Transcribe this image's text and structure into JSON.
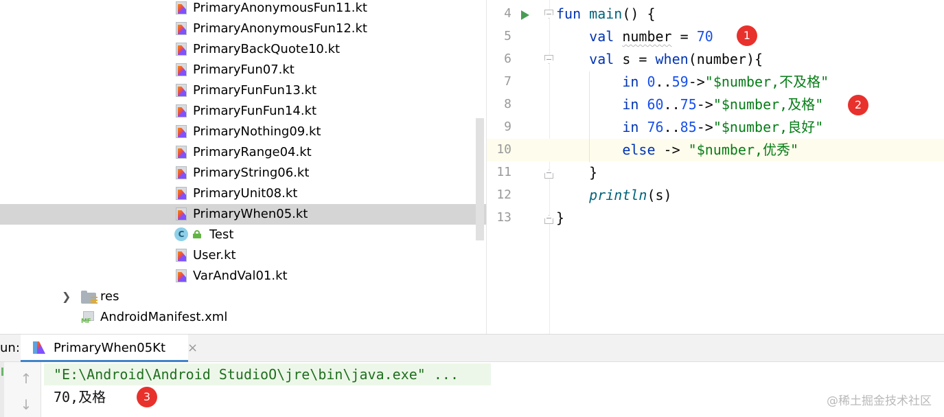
{
  "project_tree": {
    "files": [
      {
        "label": "PrimaryAnonymousFun11.kt",
        "type": "kotlin-file"
      },
      {
        "label": "PrimaryAnonymousFun12.kt",
        "type": "kotlin-file"
      },
      {
        "label": "PrimaryBackQuote10.kt",
        "type": "kotlin-file"
      },
      {
        "label": "PrimaryFun07.kt",
        "type": "kotlin-file"
      },
      {
        "label": "PrimaryFunFun13.kt",
        "type": "kotlin-file"
      },
      {
        "label": "PrimaryFunFun14.kt",
        "type": "kotlin-file"
      },
      {
        "label": "PrimaryNothing09.kt",
        "type": "kotlin-file"
      },
      {
        "label": "PrimaryRange04.kt",
        "type": "kotlin-file"
      },
      {
        "label": "PrimaryString06.kt",
        "type": "kotlin-file"
      },
      {
        "label": "PrimaryUnit08.kt",
        "type": "kotlin-file"
      },
      {
        "label": "PrimaryWhen05.kt",
        "type": "kotlin-file",
        "selected": true
      },
      {
        "label": "Test",
        "type": "class"
      },
      {
        "label": "User.kt",
        "type": "kotlin-file"
      },
      {
        "label": "VarAndVal01.kt",
        "type": "kotlin-file"
      }
    ],
    "res_folder": "res",
    "manifest": "AndroidManifest.xml",
    "manifest_icon_text": "MF",
    "class_icon_letter": "C"
  },
  "editor": {
    "line_numbers": [
      "4",
      "5",
      "6",
      "7",
      "8",
      "9",
      "10",
      "11",
      "12",
      "13"
    ],
    "current_line": "10",
    "code": {
      "l4": {
        "kw": "fun",
        "fn": "main",
        "rest": "() {"
      },
      "l5": {
        "kw": "val",
        "name": "number",
        "op": " = ",
        "num": "70"
      },
      "l6": {
        "kw1": "val",
        "mid": " s = ",
        "kw2": "when",
        "rest": "(number){"
      },
      "l7": {
        "kw": "in",
        "n1": "0",
        "dots": "..",
        "n2": "59",
        "arrow": "->",
        "str": "\"$number,不及格\""
      },
      "l8": {
        "kw": "in",
        "n1": "60",
        "dots": "..",
        "n2": "75",
        "arrow": "->",
        "str": "\"$number,及格\""
      },
      "l9": {
        "kw": "in",
        "n1": "76",
        "dots": "..",
        "n2": "85",
        "arrow": "->",
        "str": "\"$number,良好\""
      },
      "l10": {
        "kw": "else",
        "arrow": " -> ",
        "str": "\"$number,优秀\""
      },
      "l11": {
        "text": "}"
      },
      "l12": {
        "fn": "println",
        "rest": "(s)"
      },
      "l13": {
        "text": "}"
      }
    },
    "annotations": [
      "1",
      "2"
    ]
  },
  "run_panel": {
    "label": "un:",
    "tab_label": "PrimaryWhen05Kt",
    "tab_close": "×",
    "up_arrow": "↑",
    "down_arrow": "↓",
    "console": {
      "command": "\"E:\\Android\\Android StudioO\\jre\\bin\\java.exe\" ...",
      "output": "70,及格"
    },
    "annotation": "3",
    "watermark": "@稀土掘金技术社区"
  },
  "colors": {
    "keyword": "#0033b3",
    "number": "#1750eb",
    "string": "#067d17",
    "function": "#00627a",
    "annotation_badge": "#e8312c",
    "selection": "#d5d5d5",
    "current_line": "#fefcec"
  }
}
